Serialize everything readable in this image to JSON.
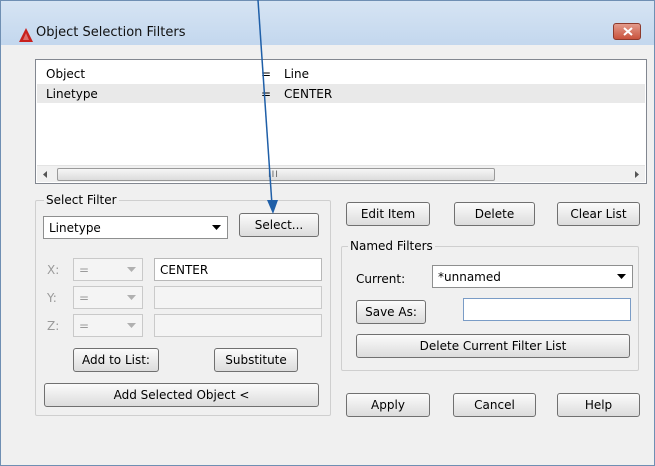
{
  "window": {
    "title": "Object Selection Filters",
    "icons": {
      "app": "autocad-logo-icon",
      "close": "close-icon"
    }
  },
  "filter_list": {
    "rows": [
      {
        "col1": "Object",
        "col2": "=",
        "col3": "Line"
      },
      {
        "col1": "Linetype",
        "col2": "=",
        "col3": "CENTER"
      }
    ],
    "scrollbar_grip": "III"
  },
  "select_filter": {
    "group_label": "Select Filter",
    "type_value": "Linetype",
    "select_button": "Select...",
    "x_label": "X:",
    "y_label": "Y:",
    "z_label": "Z:",
    "x_op": "=",
    "y_op": "=",
    "z_op": "=",
    "x_value": "CENTER",
    "add_to_list_button": "Add to List:",
    "substitute_button": "Substitute",
    "add_selected_object_button": "Add Selected Object <"
  },
  "list_buttons": {
    "edit_item": "Edit Item",
    "delete": "Delete",
    "clear_list": "Clear List"
  },
  "named_filters": {
    "group_label": "Named Filters",
    "current_label": "Current:",
    "current_value": "*unnamed",
    "save_as_button": "Save As:",
    "save_as_value": "",
    "delete_current_button": "Delete Current Filter List"
  },
  "bottom_buttons": {
    "apply": "Apply",
    "cancel": "Cancel",
    "help": "Help"
  },
  "colors": {
    "titlebar": "#c9dbef",
    "pointer_arrow": "#1f5fa8",
    "close_button": "#c9533d"
  }
}
